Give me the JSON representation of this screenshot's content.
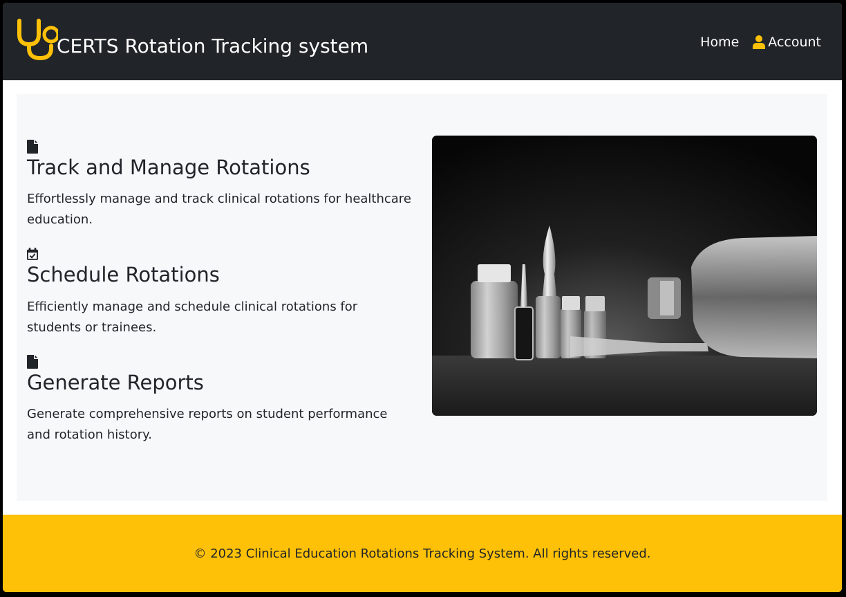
{
  "navbar": {
    "brand_text": "CERTS Rotation Tracking system",
    "links": [
      {
        "label": "Home",
        "icon": ""
      },
      {
        "label": "Account",
        "icon": "user-icon"
      }
    ]
  },
  "features": [
    {
      "icon": "file-icon",
      "title": "Track and Manage Rotations",
      "description": "Effortlessly manage and track clinical rotations for healthcare education."
    },
    {
      "icon": "calendar-check-icon",
      "title": "Schedule Rotations",
      "description": "Efficiently manage and schedule clinical rotations for students or trainees."
    },
    {
      "icon": "file-icon",
      "title": "Generate Reports",
      "description": "Generate comprehensive reports on student performance and rotation history."
    }
  ],
  "hero": {
    "image": "medical-vials-photo"
  },
  "footer": {
    "text": "© 2023 Clinical Education Rotations Tracking System. All rights reserved."
  },
  "colors": {
    "navbar_bg": "#212529",
    "accent": "#ffc107",
    "panel_bg": "#f7f8fa",
    "text": "#212529"
  }
}
